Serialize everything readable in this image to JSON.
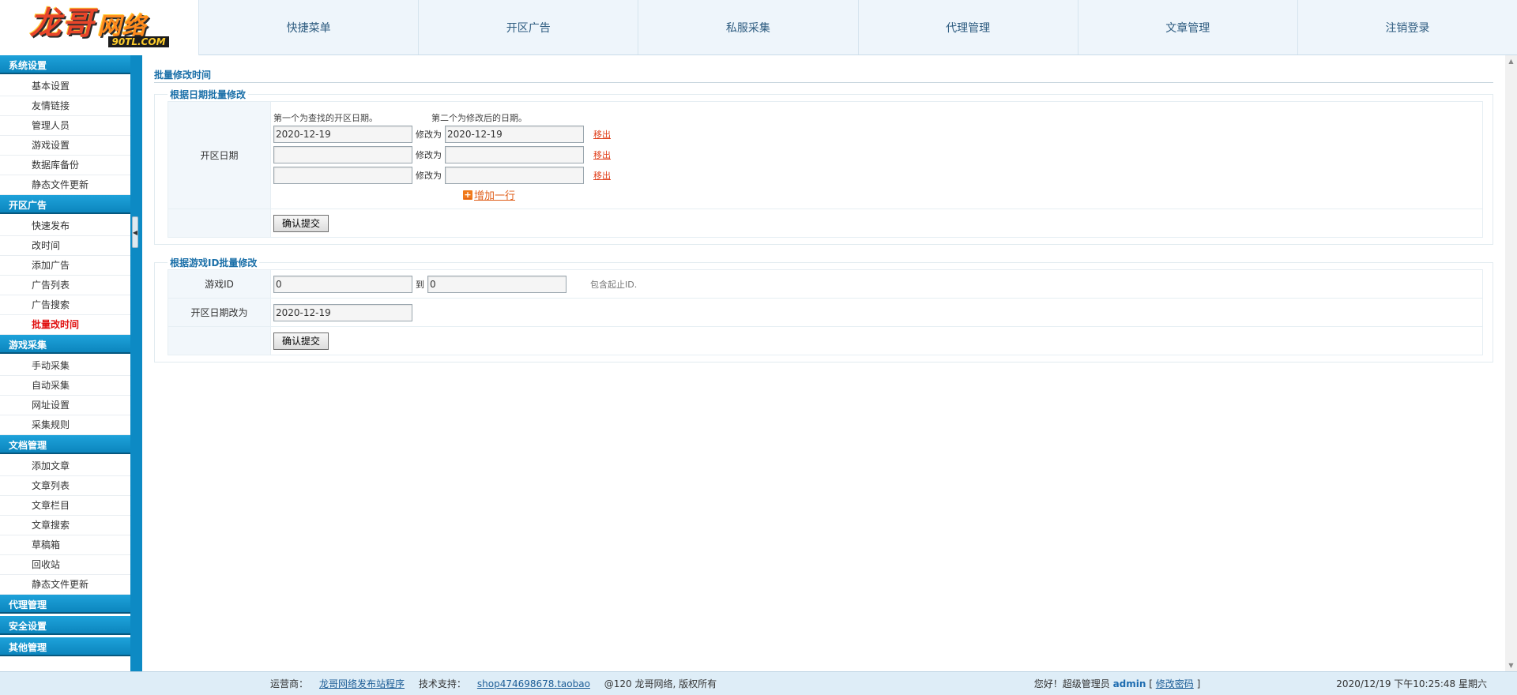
{
  "header": {
    "logo_text": "龙哥",
    "logo_text2": "网络",
    "logo_sub": "90TL.COM",
    "nav": [
      "快捷菜单",
      "开区广告",
      "私服采集",
      "代理管理",
      "文章管理",
      "注销登录"
    ]
  },
  "sidebar": {
    "groups": [
      {
        "title": "系统设置",
        "items": [
          "基本设置",
          "友情链接",
          "管理人员",
          "游戏设置",
          "数据库备份",
          "静态文件更新"
        ]
      },
      {
        "title": "开区广告",
        "items": [
          "快速发布",
          "改时间",
          "添加广告",
          "广告列表",
          "广告搜索",
          "批量改时间"
        ]
      },
      {
        "title": "游戏采集",
        "items": [
          "手动采集",
          "自动采集",
          "网址设置",
          "采集规则"
        ]
      },
      {
        "title": "文档管理",
        "items": [
          "添加文章",
          "文章列表",
          "文章栏目",
          "文章搜索",
          "草稿箱",
          "回收站",
          "静态文件更新"
        ]
      },
      {
        "title": "代理管理",
        "items": []
      },
      {
        "title": "安全设置",
        "items": []
      },
      {
        "title": "其他管理",
        "items": []
      }
    ],
    "active_item": "批量改时间"
  },
  "main": {
    "page_title": "批量修改时间",
    "section1": {
      "legend": "根据日期批量修改",
      "label": "开区日期",
      "hint_left": "第一个为查找的开区日期。",
      "hint_right": "第二个为修改后的日期。",
      "modify_to": "修改为",
      "remove": "移出",
      "rows": [
        {
          "from": "2020-12-19",
          "to": "2020-12-19"
        },
        {
          "from": "",
          "to": ""
        },
        {
          "from": "",
          "to": ""
        }
      ],
      "add_row": "增加一行",
      "submit": "确认提交"
    },
    "section2": {
      "legend": "根据游戏ID批量修改",
      "game_id_label": "游戏ID",
      "id_from": "0",
      "to_word": "到",
      "id_to": "0",
      "note": "包含起止ID.",
      "date_label": "开区日期改为",
      "date_value": "2020-12-19",
      "submit": "确认提交"
    }
  },
  "footer": {
    "operator_label": "运营商：",
    "operator_link": "龙哥网络发布站程序",
    "support_label": "技术支持：",
    "support_link": "shop474698678.taobao",
    "copyright": "@120 龙哥网络, 版权所有",
    "greeting": "您好！超级管理员",
    "username": "admin",
    "change_pwd": "修改密码",
    "bracket_open": "[",
    "bracket_close": "]",
    "datetime": "2020/12/19 下午10:25:48 星期六"
  },
  "colors": {
    "accent": "#0c8fc8",
    "header_bg": "#eef5fb",
    "active_text": "#e01010",
    "link_orange": "#e0401c"
  }
}
